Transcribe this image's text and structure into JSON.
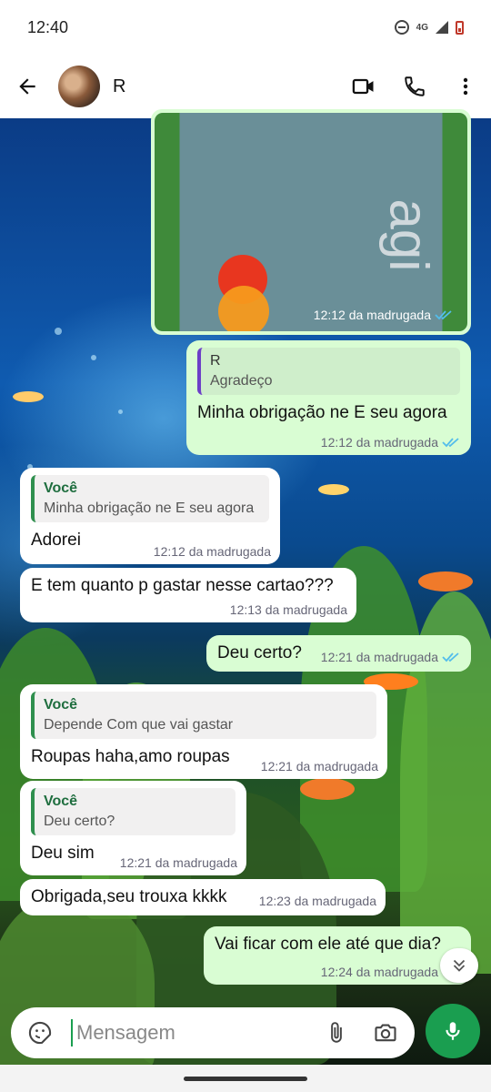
{
  "status_bar": {
    "time": "12:40",
    "network": "4G"
  },
  "header": {
    "contact_name": "R"
  },
  "image_message": {
    "time": "12:12 da madrugada",
    "card_text": "agi"
  },
  "messages": [
    {
      "direction": "out",
      "quote_author": "R",
      "quote_text": "Agradeço",
      "text": "Minha obrigação ne E seu agora",
      "time": "12:12 da madrugada"
    },
    {
      "direction": "in",
      "quote_author": "Você",
      "quote_text": "Minha obrigação ne E seu agora",
      "text": "Adorei",
      "time": "12:12 da madrugada"
    },
    {
      "direction": "in",
      "text": "E tem quanto p gastar nesse cartao???",
      "time": "12:13 da madrugada"
    },
    {
      "direction": "out",
      "text": "Deu certo?",
      "time": "12:21 da madrugada"
    },
    {
      "direction": "in",
      "quote_author": "Você",
      "quote_text": "Depende Com que vai gastar",
      "text": "Roupas haha,amo roupas",
      "time": "12:21 da madrugada"
    },
    {
      "direction": "in",
      "quote_author": "Você",
      "quote_text": "Deu certo?",
      "text": "Deu sim",
      "time": "12:21 da madrugada"
    },
    {
      "direction": "in",
      "text": "Obrigada,seu trouxa kkkk",
      "time": "12:23 da madrugada"
    },
    {
      "direction": "out",
      "text": "Vai ficar com ele  até que dia?",
      "time": "12:24 da madrugada"
    }
  ],
  "composer": {
    "placeholder": "Mensagem"
  },
  "colors": {
    "accent": "#1a9e50",
    "outgoing_bubble": "#d9fdd3",
    "incoming_bubble": "#ffffff",
    "read_ticks": "#53bdeb"
  },
  "icons": [
    "back-arrow-icon",
    "video-call-icon",
    "phone-icon",
    "more-vert-icon",
    "sticker-icon",
    "attach-icon",
    "camera-icon",
    "mic-icon",
    "scroll-down-icon",
    "double-check-icon"
  ]
}
